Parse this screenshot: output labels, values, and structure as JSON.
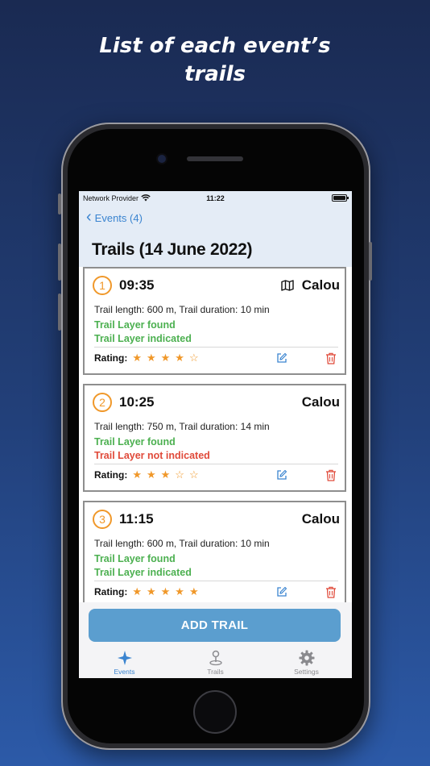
{
  "headline": {
    "line1": "List of each event’s",
    "line2": "trails"
  },
  "status_bar": {
    "carrier": "Network Provider",
    "time": "11:22"
  },
  "nav": {
    "back_label": "Events (4)",
    "title": "Trails (14 June 2022)"
  },
  "rating_label": "Rating:",
  "trails": [
    {
      "number": "1",
      "time": "09:35",
      "author": "Calou",
      "has_map": true,
      "info": "Trail length: 600 m,  Trail duration: 10 min",
      "layer_found": "Trail Layer found",
      "layer_indicated": "Trail Layer indicated",
      "indicated": true,
      "rating": 4,
      "rating_max": 5
    },
    {
      "number": "2",
      "time": "10:25",
      "author": "Calou",
      "has_map": false,
      "info": "Trail length: 750 m,  Trail duration: 14 min",
      "layer_found": "Trail Layer found",
      "layer_indicated": "Trail Layer not indicated",
      "indicated": false,
      "rating": 3,
      "rating_max": 5
    },
    {
      "number": "3",
      "time": "11:15",
      "author": "Calou",
      "has_map": false,
      "info": "Trail length: 600 m,  Trail duration: 10 min",
      "layer_found": "Trail Layer found",
      "layer_indicated": "Trail Layer indicated",
      "indicated": true,
      "rating": 5,
      "rating_max": 5
    }
  ],
  "add_button": "ADD TRAIL",
  "tabs": [
    {
      "label": "Events",
      "icon": "sparkle-icon",
      "active": true
    },
    {
      "label": "Trails",
      "icon": "location-pin-icon",
      "active": false
    },
    {
      "label": "Settings",
      "icon": "gear-icon",
      "active": false
    }
  ],
  "colors": {
    "accent": "#3a84d0",
    "orange": "#f0982a",
    "found_green": "#4cb050",
    "not_indicated_red": "#e04a3a",
    "button": "#5b9ecf"
  }
}
